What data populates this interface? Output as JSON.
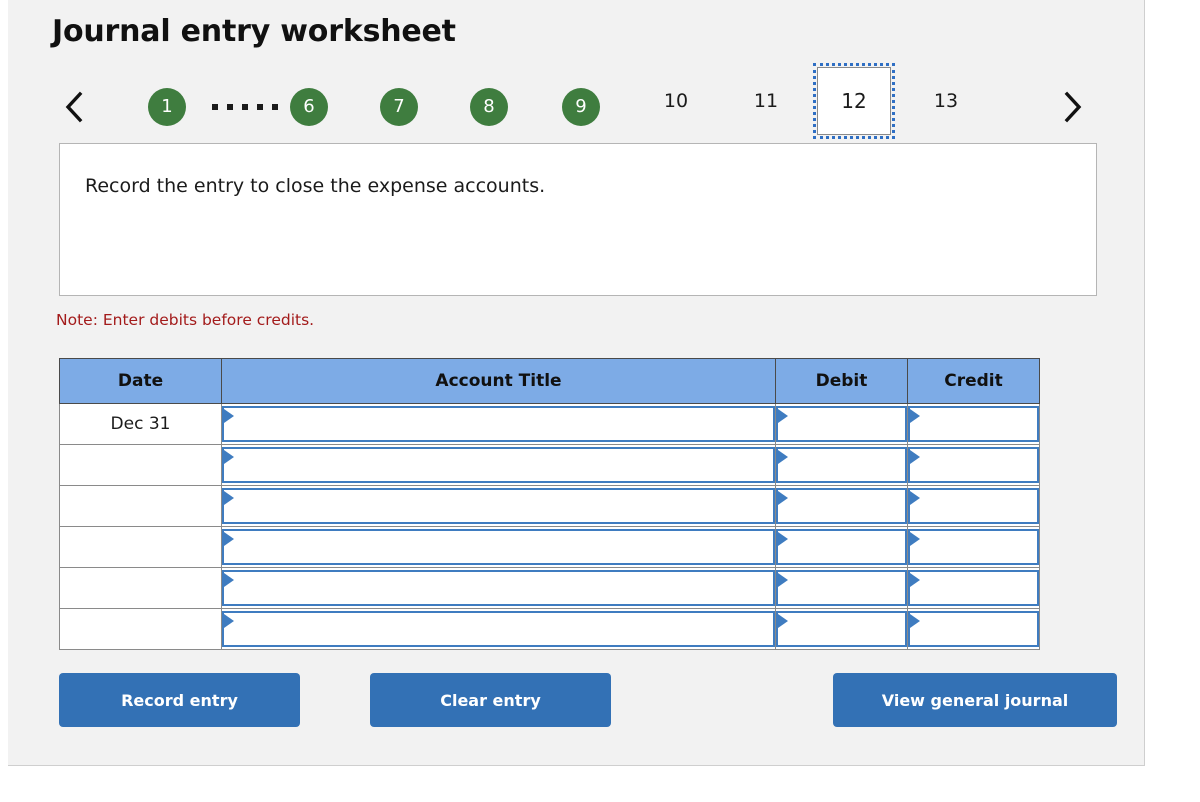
{
  "header": {
    "title": "Journal entry worksheet"
  },
  "pager": {
    "prev_label": "Previous",
    "next_label": "Next",
    "prev_icon": "chevron-left-icon",
    "next_icon": "chevron-right-icon",
    "ellipsis": "• • • • •",
    "items": [
      {
        "label": "1",
        "state": "completed"
      },
      {
        "label": "6",
        "state": "completed"
      },
      {
        "label": "7",
        "state": "completed"
      },
      {
        "label": "8",
        "state": "completed"
      },
      {
        "label": "9",
        "state": "completed"
      },
      {
        "label": "10",
        "state": "plain"
      },
      {
        "label": "11",
        "state": "plain"
      },
      {
        "label": "12",
        "state": "current"
      },
      {
        "label": "13",
        "state": "plain"
      }
    ],
    "completed_color": "#3f7d3f",
    "current_border_color": "#2f6fc4"
  },
  "instruction": {
    "text": "Record the entry to close the expense accounts."
  },
  "note": {
    "text": "Note: Enter debits before credits.",
    "color": "#a31b1b"
  },
  "table": {
    "header_color": "#7dabe6",
    "columns": [
      "Date",
      "Account Title",
      "Debit",
      "Credit"
    ],
    "rows": [
      {
        "date": "Dec 31",
        "account": "",
        "debit": "",
        "credit": ""
      },
      {
        "date": "",
        "account": "",
        "debit": "",
        "credit": ""
      },
      {
        "date": "",
        "account": "",
        "debit": "",
        "credit": ""
      },
      {
        "date": "",
        "account": "",
        "debit": "",
        "credit": ""
      },
      {
        "date": "",
        "account": "",
        "debit": "",
        "credit": ""
      },
      {
        "date": "",
        "account": "",
        "debit": "",
        "credit": ""
      }
    ]
  },
  "buttons": {
    "record": "Record entry",
    "clear": "Clear entry",
    "view": "View general journal",
    "color": "#3371b5"
  }
}
